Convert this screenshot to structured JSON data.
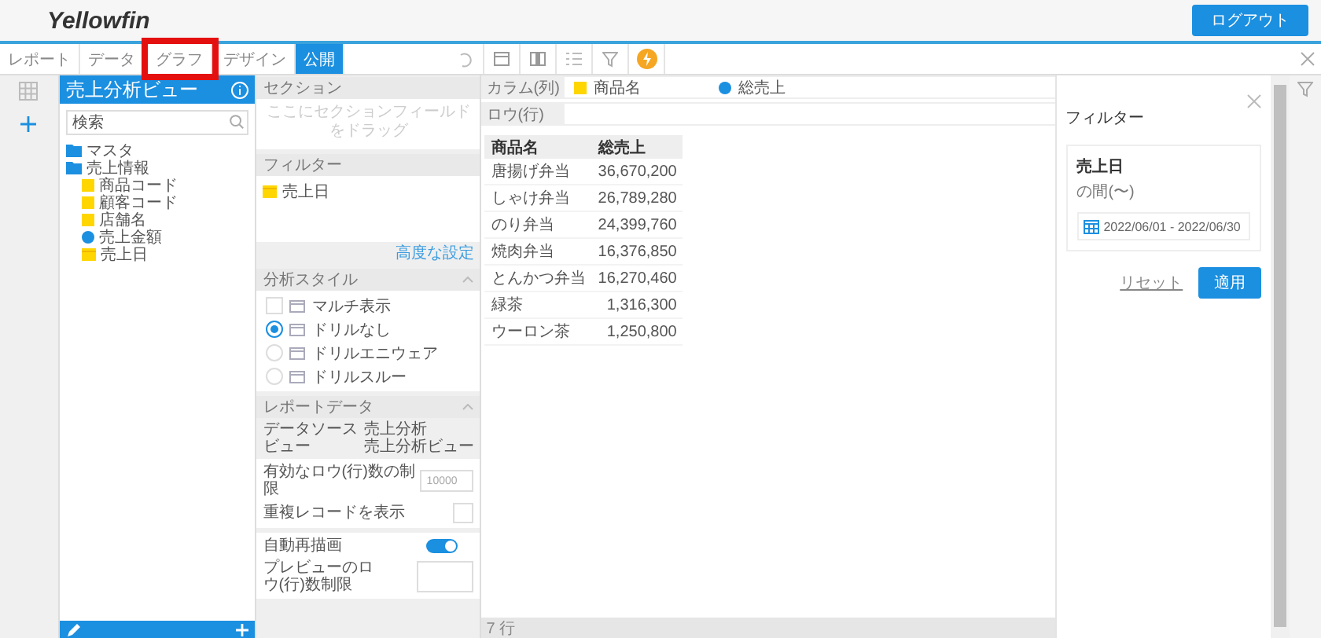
{
  "header": {
    "logo": "Yellowfin",
    "logout": "ログアウト"
  },
  "tabs": [
    {
      "label": "レポート",
      "selected": false,
      "highlighted": false
    },
    {
      "label": "データ",
      "selected": false,
      "highlighted": false
    },
    {
      "label": "グラフ",
      "selected": false,
      "highlighted": true
    },
    {
      "label": "デザイン",
      "selected": false,
      "highlighted": false
    },
    {
      "label": "公開",
      "selected": true,
      "highlighted": false
    }
  ],
  "data_panel": {
    "title": "売上分析ビュー",
    "search": {
      "placeholder": "検索"
    },
    "tree": [
      {
        "label": "マスタ",
        "kind": "folder"
      },
      {
        "label": "売上情報",
        "kind": "folder",
        "children": [
          {
            "label": "商品コード",
            "kind": "dimension"
          },
          {
            "label": "顧客コード",
            "kind": "dimension"
          },
          {
            "label": "店舗名",
            "kind": "dimension"
          },
          {
            "label": "売上金額",
            "kind": "metric"
          },
          {
            "label": "売上日",
            "kind": "date"
          }
        ]
      }
    ]
  },
  "section": {
    "title": "セクション",
    "placeholder": "ここにセクションフィールドをドラッグ"
  },
  "filters": {
    "title": "フィルター",
    "items": [
      {
        "label": "売上日",
        "kind": "date"
      }
    ],
    "advanced": "高度な設定"
  },
  "analysis_style": {
    "title": "分析スタイル",
    "options": [
      {
        "label": "マルチ表示",
        "kind": "checkbox",
        "checked": false
      },
      {
        "label": "ドリルなし",
        "kind": "radio",
        "selected": true
      },
      {
        "label": "ドリルエニウェア",
        "kind": "radio",
        "selected": false
      },
      {
        "label": "ドリルスルー",
        "kind": "radio",
        "selected": false
      }
    ]
  },
  "report_data": {
    "title": "レポートデータ",
    "rows": [
      {
        "label": "データソース",
        "value": "売上分析"
      },
      {
        "label": "ビュー",
        "value": "売上分析ビュー"
      }
    ],
    "row_limit": {
      "label": "有効なロウ(行)数の制限",
      "placeholder": "10000"
    },
    "show_duplicates": {
      "label": "重複レコードを表示",
      "checked": false
    },
    "auto_refresh": {
      "label": "自動再描画",
      "on": true
    },
    "preview_limit": {
      "label": "プレビューのロウ(行)数制限"
    }
  },
  "columns_zone": {
    "label": "カラム(列)",
    "fields": [
      {
        "label": "商品名",
        "kind": "dimension"
      },
      {
        "label": "総売上",
        "kind": "metric"
      }
    ]
  },
  "rows_zone": {
    "label": "ロウ(行)"
  },
  "table": {
    "columns": [
      "商品名",
      "総売上"
    ],
    "rows": [
      [
        "唐揚げ弁当",
        "36,670,200"
      ],
      [
        "しゃけ弁当",
        "26,789,280"
      ],
      [
        "のり弁当",
        "24,399,760"
      ],
      [
        "焼肉弁当",
        "16,376,850"
      ],
      [
        "とんかつ弁当",
        "16,270,460"
      ],
      [
        "緑茶",
        "1,316,300"
      ],
      [
        "ウーロン茶",
        "1,250,800"
      ]
    ]
  },
  "row_count": "7 行",
  "filter_panel": {
    "title": "フィルター",
    "field": "売上日",
    "operator": "の間(〜)",
    "range": "2022/06/01 - 2022/06/30",
    "reset": "リセット",
    "apply": "適用"
  }
}
